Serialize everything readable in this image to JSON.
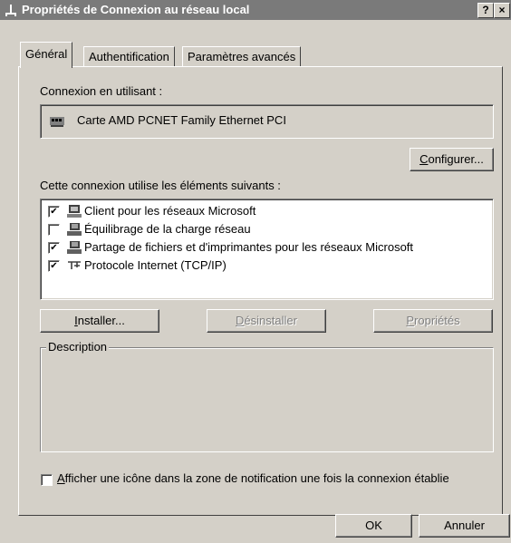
{
  "window": {
    "title": "Propriétés de Connexion au réseau local",
    "help_label": "?",
    "close_label": "×"
  },
  "tabs": [
    {
      "label": "Général"
    },
    {
      "label": "Authentification"
    },
    {
      "label": "Paramètres avancés"
    }
  ],
  "connection": {
    "label": "Connexion en utilisant :",
    "adapter_name": "Carte AMD PCNET Family Ethernet PCI",
    "configure_button_rest": "onfigurer...",
    "configure_button_key": "C"
  },
  "components": {
    "label": "Cette connexion utilise les éléments suivants :",
    "items": [
      {
        "checked": true,
        "icon": "client-icon",
        "label": "Client pour les réseaux Microsoft"
      },
      {
        "checked": false,
        "icon": "computer-icon",
        "label": "Équilibrage de la charge réseau"
      },
      {
        "checked": true,
        "icon": "computer-icon",
        "label": "Partage de fichiers et d'imprimantes pour les réseaux Microsoft"
      },
      {
        "checked": true,
        "icon": "network-protocol-icon",
        "label": "Protocole Internet (TCP/IP)"
      }
    ]
  },
  "actions": {
    "install_key": "I",
    "install_rest": "nstaller...",
    "uninstall_key": "D",
    "uninstall_rest": "ésinstaller",
    "properties_key": "P",
    "properties_rest": "ropriétés"
  },
  "description": {
    "legend": "Description",
    "text": ""
  },
  "notify": {
    "checked": false,
    "label_key": "A",
    "label_rest": "fficher une icône dans la zone de notification une fois la connexion établie"
  },
  "footer": {
    "ok_label": "OK",
    "cancel_label": "Annuler"
  }
}
